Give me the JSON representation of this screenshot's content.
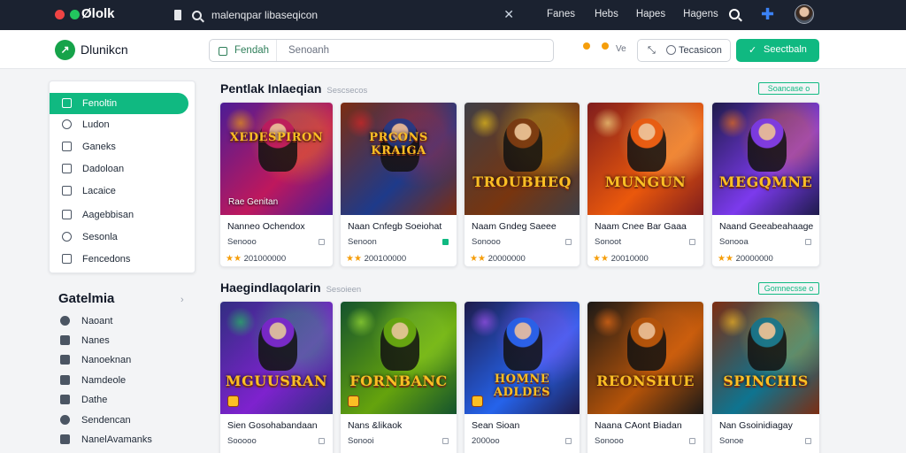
{
  "topbar": {
    "window_dots": [
      "#ef4444",
      "#22c55e",
      "#d1d5db"
    ],
    "logo": "Ølolk",
    "search_text": "malenqpar libaseqicon",
    "nav": [
      "Fanes",
      "Hebs",
      "Hapes",
      "Hagens"
    ],
    "icons": [
      "search-icon",
      "puzzle-icon",
      "avatar"
    ]
  },
  "appbar": {
    "brand": "Dlunikcn",
    "search_category": "Fendah",
    "search_placeholder": "Senoanh",
    "badge": "Ve",
    "filter_button": "Tecasicon",
    "cta_button": "Seectbaln",
    "accent": "#10b981"
  },
  "sidebar": {
    "items": [
      {
        "label": "Fenoltin",
        "active": true
      },
      {
        "label": "Ludon"
      },
      {
        "label": "Ganeks"
      },
      {
        "label": "Dadoloan"
      },
      {
        "label": "Lacaice"
      },
      {
        "label": "Aagebbisan"
      },
      {
        "label": "Sesonla"
      },
      {
        "label": "Fencedons"
      }
    ],
    "categories_title": "Gatelmia",
    "categories": [
      {
        "label": "Naoant"
      },
      {
        "label": "Nanes"
      },
      {
        "label": "Nanoeknan"
      },
      {
        "label": "Namdeole"
      },
      {
        "label": "Dathe"
      },
      {
        "label": "Sendencan"
      },
      {
        "label": "NanelAvamanks"
      }
    ]
  },
  "section1": {
    "title": "Pentlak Inlaeqian",
    "subtitle": "Sescsecos",
    "button": "Soancase o",
    "cards": [
      {
        "game_title": "XEDESPIRON",
        "caption": "Rae Genitan",
        "name": "Nanneo Ochendox",
        "sub": "Senooo",
        "rating_stars": "★★",
        "rating_text": "201000000",
        "colors": [
          "#4c1d95",
          "#be185d",
          "#f59e0b"
        ]
      },
      {
        "game_title": "PRCONS KRAIGA",
        "caption": "",
        "name": "Naan Cnfegb Soeiohat",
        "sub": "Senoon",
        "rating_stars": "★★",
        "rating_text": "200100000",
        "colors": [
          "#7c2d12",
          "#1e3a8a",
          "#dc2626"
        ]
      },
      {
        "game_title": "TROUBHEQ",
        "caption": "",
        "name": "Naam Gndeg Saeee",
        "sub": "Sonooo",
        "rating_stars": "★★",
        "rating_text": "20000000",
        "colors": [
          "#3f3f46",
          "#78350f",
          "#facc15"
        ]
      },
      {
        "game_title": "MUNGUN",
        "caption": "",
        "name": "Naam Cnee Bar Gaaa",
        "sub": "Sonoot",
        "rating_stars": "★★",
        "rating_text": "20010000",
        "colors": [
          "#7f1d1d",
          "#ea580c",
          "#fde68a"
        ]
      },
      {
        "game_title": "MEGQMNE",
        "caption": "",
        "name": "Naand Geeabeahaage",
        "sub": "Sonooa",
        "rating_stars": "★★",
        "rating_text": "20000000",
        "colors": [
          "#1e1b4b",
          "#7c3aed",
          "#f97316"
        ]
      }
    ]
  },
  "section2": {
    "title": "Haegindlaqolarin",
    "subtitle": "Sesoieen",
    "button": "Gomnecsse o",
    "cards": [
      {
        "game_title": "MGUUSRAN",
        "name": "Sien Gosohabandaan",
        "sub": "Sooooo",
        "rating_stars": "★★",
        "rating_text": "200000000",
        "colors": [
          "#312e81",
          "#7e22ce",
          "#22c55e"
        ]
      },
      {
        "game_title": "FORNBANC",
        "name": "Nans &likaok",
        "sub": "Sonooi",
        "rating_stars": "★★",
        "rating_text": "20010eono",
        "colors": [
          "#14532d",
          "#65a30d",
          "#a3e635"
        ]
      },
      {
        "game_title": "HOMNE ADLDES",
        "name": "Sean Sioan",
        "sub": "2000oo",
        "rating_stars": "★★",
        "rating_text": "200000000",
        "colors": [
          "#1e1b4b",
          "#2563eb",
          "#a855f7"
        ]
      },
      {
        "game_title": "REONSHUE",
        "name": "Naana CAont Biadan",
        "sub": "Sonooo",
        "rating_stars": "★★",
        "rating_text": "20000000",
        "colors": [
          "#1c1917",
          "#b45309",
          "#f97316"
        ]
      },
      {
        "game_title": "SPINCHIS",
        "name": "Nan Gsoinidiagay",
        "sub": "Sonoe",
        "rating_stars": "★★",
        "rating_text": "200 50000",
        "colors": [
          "#7c2d12",
          "#0e7490",
          "#fbbf24"
        ]
      }
    ]
  }
}
